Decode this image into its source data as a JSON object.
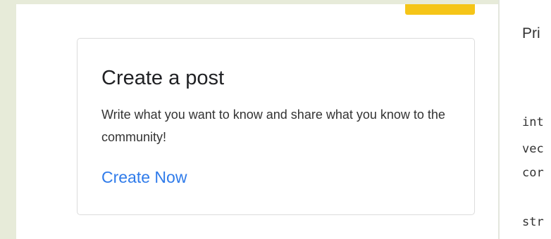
{
  "card": {
    "title": "Create a post",
    "description": "Write what you want to know and share what you know to the community!",
    "link_label": "Create Now"
  },
  "side_panel": {
    "heading": "Pri",
    "code_lines": [
      "int",
      "vec",
      "cor",
      "str"
    ]
  },
  "colors": {
    "page_background": "#e7ebd9",
    "accent_button": "#f5c518",
    "link": "#2f7bea"
  }
}
